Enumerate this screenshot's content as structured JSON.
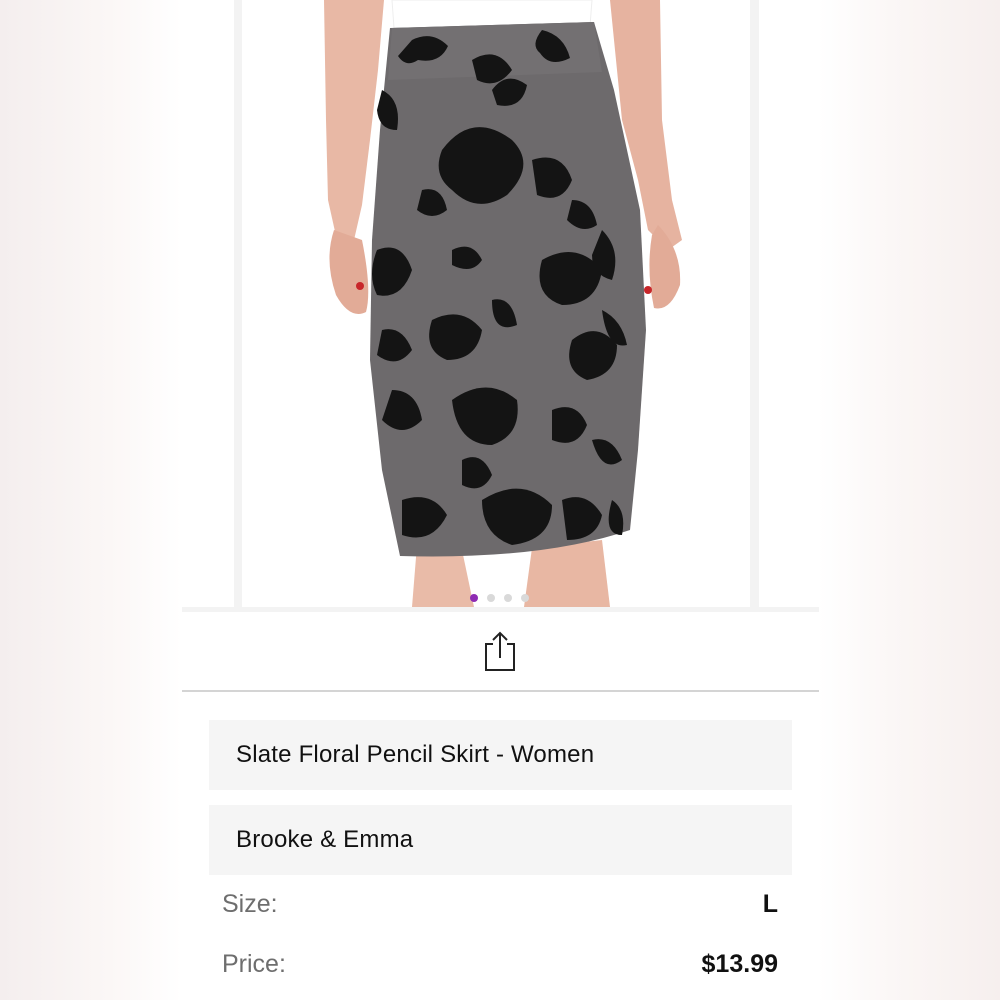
{
  "product": {
    "title": "Slate Floral Pencil Skirt - Women",
    "brand": "Brooke & Emma",
    "size_label": "Size:",
    "size_value": "L",
    "price_label": "Price:",
    "price_value": "$13.99"
  },
  "carousel": {
    "slide_count": 4,
    "active_index": 0,
    "active_dot_color": "#8e2bb3",
    "inactive_dot_color": "#d9d9d9"
  },
  "actions": {
    "share_icon": "share-icon"
  },
  "colors": {
    "skirt_base": "#6d6a6c",
    "floral": "#141414",
    "field_bg": "#f5f5f5",
    "divider": "#d4d4d4"
  }
}
